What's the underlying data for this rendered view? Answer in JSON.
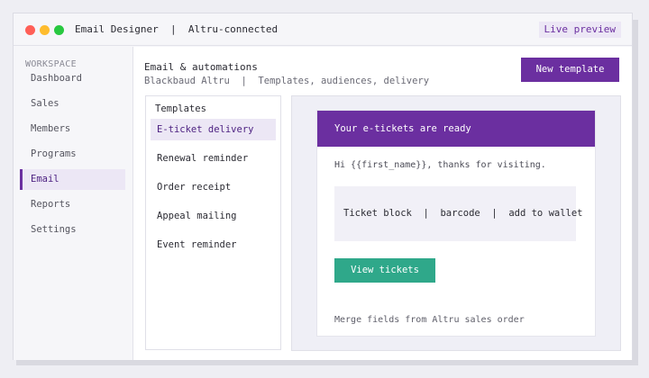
{
  "window": {
    "title": "Email Designer  |  Altru-connected",
    "badge": "Live preview"
  },
  "sidebar": {
    "section_label": "WORKSPACE",
    "items": [
      {
        "label": "Dashboard"
      },
      {
        "label": "Sales"
      },
      {
        "label": "Members"
      },
      {
        "label": "Programs"
      },
      {
        "label": "Email"
      },
      {
        "label": "Reports"
      },
      {
        "label": "Settings"
      }
    ],
    "active": "Email"
  },
  "header": {
    "title": "Email & automations",
    "subtitle": "Blackbaud Altru  |  Templates, audiences, delivery",
    "new_template_label": "New template"
  },
  "templates": {
    "title": "Templates",
    "items": [
      {
        "label": "E-ticket delivery"
      },
      {
        "label": "Renewal reminder"
      },
      {
        "label": "Order receipt"
      },
      {
        "label": "Appeal mailing"
      },
      {
        "label": "Event reminder"
      }
    ],
    "active": "E-ticket delivery"
  },
  "preview": {
    "header": "Your e-tickets are ready",
    "greeting": "Hi {{first_name}}, thanks for visiting.",
    "ticket_block": "Ticket block  |  barcode  |  add to wallet",
    "cta_label": "View tickets",
    "footnote": "Merge fields from Altru sales order"
  },
  "colors": {
    "accent": "#6b2fa0",
    "accent_light": "#ece7f5",
    "cta": "#2fa88a"
  }
}
